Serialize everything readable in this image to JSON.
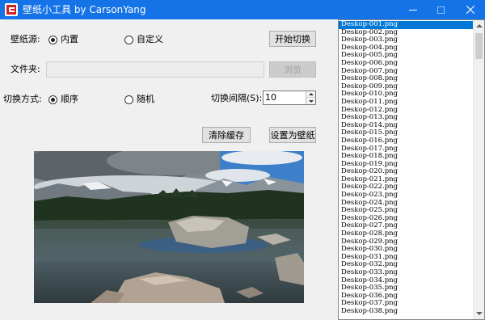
{
  "window": {
    "title": "壁纸小工具 by CarsonYang",
    "icons": [
      "app-icon",
      "minimize-icon",
      "maximize-icon",
      "close-icon"
    ]
  },
  "form": {
    "source_label": "壁纸源:",
    "source_options": [
      {
        "label": "内置",
        "checked": true
      },
      {
        "label": "自定义",
        "checked": false
      }
    ],
    "start_button": "开始切换",
    "folder_label": "文件夹:",
    "folder_value": "",
    "browse_button": "浏览",
    "mode_label": "切换方式:",
    "mode_options": [
      {
        "label": "顺序",
        "checked": true
      },
      {
        "label": "随机",
        "checked": false
      }
    ],
    "interval_label": "切换间隔(S):",
    "interval_value": "10",
    "clear_cache_button": "清除缓存",
    "set_wallpaper_button": "设置为壁纸"
  },
  "preview": {
    "icon": "landscape-preview-image"
  },
  "file_list": {
    "selected_index": 0,
    "items": [
      "Deskop-001.png",
      "Deskop-002.png",
      "Deskop-003.png",
      "Deskop-004.png",
      "Deskop-005.png",
      "Deskop-006.png",
      "Deskop-007.png",
      "Deskop-008.png",
      "Deskop-009.png",
      "Deskop-010.png",
      "Deskop-011.png",
      "Deskop-012.png",
      "Deskop-013.png",
      "Deskop-014.png",
      "Deskop-015.png",
      "Deskop-016.png",
      "Deskop-017.png",
      "Deskop-018.png",
      "Deskop-019.png",
      "Deskop-020.png",
      "Deskop-021.png",
      "Deskop-022.png",
      "Deskop-023.png",
      "Deskop-024.png",
      "Deskop-025.png",
      "Deskop-026.png",
      "Deskop-027.png",
      "Deskop-028.png",
      "Deskop-029.png",
      "Deskop-030.png",
      "Deskop-031.png",
      "Deskop-032.png",
      "Deskop-033.png",
      "Deskop-034.png",
      "Deskop-035.png",
      "Deskop-036.png",
      "Deskop-037.png",
      "Deskop-038.png"
    ]
  },
  "colors": {
    "titlebar": "#1473e6",
    "selection": "#0078d7",
    "window_bg": "#f0f0f0"
  }
}
